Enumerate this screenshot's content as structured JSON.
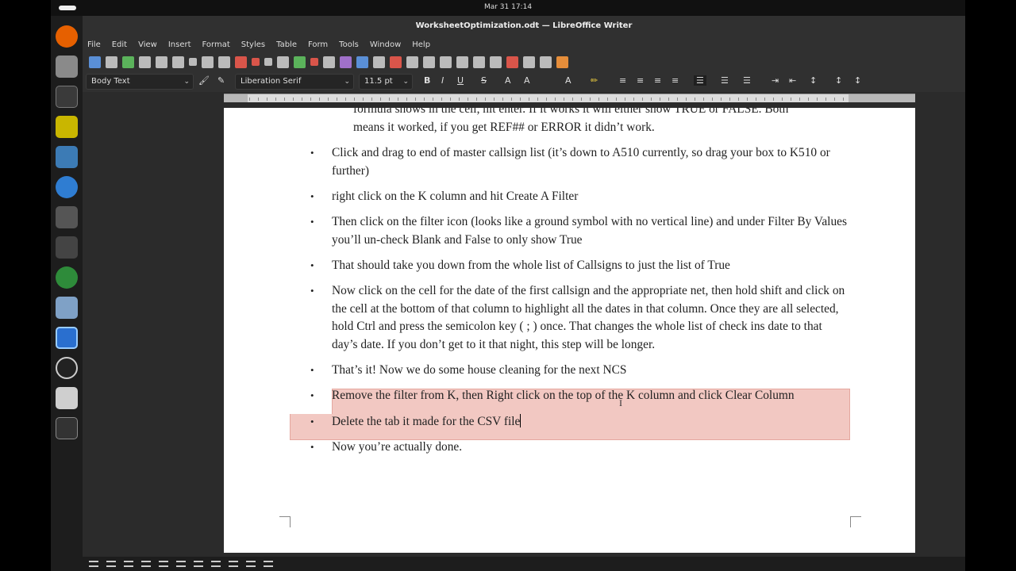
{
  "topbar": {
    "datetime": "Mar 31  17:14"
  },
  "window": {
    "title": "WorksheetOptimization.odt — LibreOffice Writer"
  },
  "menu": [
    "File",
    "Edit",
    "View",
    "Insert",
    "Format",
    "Styles",
    "Table",
    "Form",
    "Tools",
    "Window",
    "Help"
  ],
  "formatting": {
    "paragraph_style": "Body Text",
    "font_name": "Liberation Serif",
    "font_size": "11.5 pt"
  },
  "document": {
    "partial_lines": [
      "formula shows in the cell, hit enter. If it works it will either show TRUE or FALSE. Both",
      "means it worked, if you get REF## or ERROR it didn’t work."
    ],
    "items": [
      {
        "text": "Click and drag to end of master callsign list (it’s down to A510 currently, so drag your box to K510 or further)"
      },
      {
        "text": "right click on the K column and hit Create A Filter"
      },
      {
        "text": "Then click on the filter icon (looks like a ground symbol with no vertical line) and under Filter By Values you’ll un-check Blank and False to only show True"
      },
      {
        "text": "That should take you down from the whole list of Callsigns to just the list of True"
      },
      {
        "text": "Now click on the cell for the date of the first callsign and the appropriate net, then hold shift and click on the cell at the bottom of that column to highlight all the dates in that column. Once they are all selected, hold Ctrl and press the semicolon key ( ; ) once. That changes the whole list of check ins date to that day’s date. If you don’t get to it that night, this step will be longer."
      },
      {
        "text": "That’s it! Now we do some house cleaning for the next NCS"
      },
      {
        "text": "Remove the filter from K, then Right click on the top of the K column and click Clear Column"
      },
      {
        "text": "Delete the tab it made for the CSV file"
      },
      {
        "text": "Now you’re actually done."
      }
    ]
  }
}
